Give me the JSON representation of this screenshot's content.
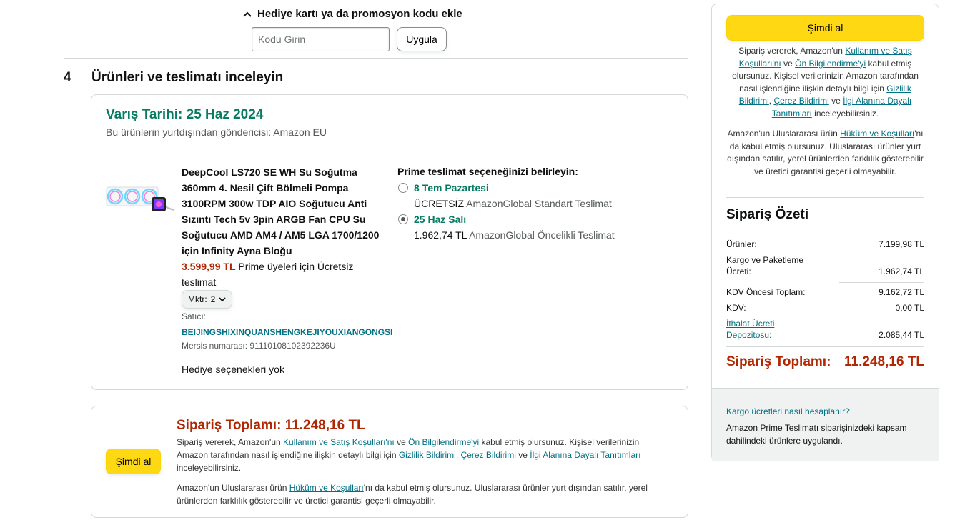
{
  "promo": {
    "toggle_label": "Hediye kartı ya da promosyon kodu ekle",
    "input_placeholder": "Kodu Girin",
    "apply_label": "Uygula"
  },
  "review": {
    "step_number": "4",
    "step_title": "Ürünleri ve teslimatı inceleyin",
    "delivery_date": "Varış Tarihi: 25 Haz 2024",
    "shipper": "Bu ürünlerin yurtdışından göndericisi: Amazon EU",
    "product": {
      "title": "DeepCool LS720 SE WH Su Soğutma 360mm 4. Nesil Çift Bölmeli Pompa 3100RPM 300w TDP AIO Soğutucu Anti Sızıntı Tech 5v 3pin ARGB Fan CPU Su Soğutucu AMD AM4 / AM5 LGA 1700/1200 için Infinity Ayna Bloğu",
      "price": "3.599,99 TL",
      "price_note": "Prime üyeleri için Ücretsiz teslimat",
      "qty_label": "Mktr:",
      "qty_value": "2",
      "seller_label": "Satıcı:",
      "seller_name": "BEIJINGSHIXINQUANSHENGKEJIYOUXIANGONGSI",
      "mersis_label": "Mersis numarası:",
      "mersis_value": "91110108102392236U",
      "gift": "Hediye seçenekleri yok"
    },
    "prime": {
      "heading": "Prime teslimat seçeneğinizi belirleyin:",
      "options": [
        {
          "title": "8 Tem Pazartesi",
          "price": "ÜCRETSİZ",
          "service": "AmazonGlobal Standart Teslimat",
          "selected": false
        },
        {
          "title": "25 Haz Salı",
          "price": "1.962,74 TL",
          "service": "AmazonGlobal Öncelikli Teslimat",
          "selected": true
        }
      ]
    }
  },
  "bottom": {
    "buy_label": "Şimdi al",
    "total_label": "Sipariş Toplamı:",
    "total_value": "11.248,16 TL"
  },
  "legal": {
    "p1_a": "Sipariş vererek, Amazon'un",
    "terms_link": "Kullanım ve Satış Koşulları'nı",
    "p1_b": "ve",
    "preinfo_link": "Ön Bilgilendirme'yi",
    "p1_c": "kabul etmiş olursunuz. Kişisel verilerinizin Amazon tarafından nasıl işlendiğine ilişkin detaylı bilgi için",
    "privacy_link": "Gizlilik Bildirimi",
    "comma": ",",
    "cookie_link": "Çerez Bildirimi",
    "p1_d": "ve",
    "ads_link": "İlgi Alanına Dayalı Tanıtımları",
    "p1_e": "inceleyebilirsiniz.",
    "p2_a": "Amazon'un Uluslararası ürün",
    "intl_link": "Hüküm ve Koşulları",
    "p2_b": "'nı da kabul etmiş olursunuz. Uluslararası ürünler yurt dışından satılır, yerel ürünlerden farklılık gösterebilir ve üretici garantisi geçerli olmayabilir."
  },
  "summary": {
    "buy_label": "Şimdi al",
    "title": "Sipariş Özeti",
    "rows": [
      {
        "label": "Ürünler:",
        "value": "7.199,98 TL"
      },
      {
        "label": "Kargo ve Paketleme Ücreti:",
        "value": "1.962,74 TL"
      },
      {
        "label": "KDV Öncesi Toplam:",
        "value": "9.162,72 TL"
      },
      {
        "label": "KDV:",
        "value": "0,00 TL"
      },
      {
        "label": "İthalat Ücreti Depozitosu:",
        "value": "2.085,44 TL"
      }
    ],
    "total_label": "Sipariş Toplamı:",
    "total_value": "11.248,16 TL",
    "cargo_link": "Kargo ücretleri nasıl hesaplanır?",
    "prime_note": "Amazon Prime Teslimatı siparişinizdeki kapsam dahilindeki ürünlere uygulandı."
  }
}
